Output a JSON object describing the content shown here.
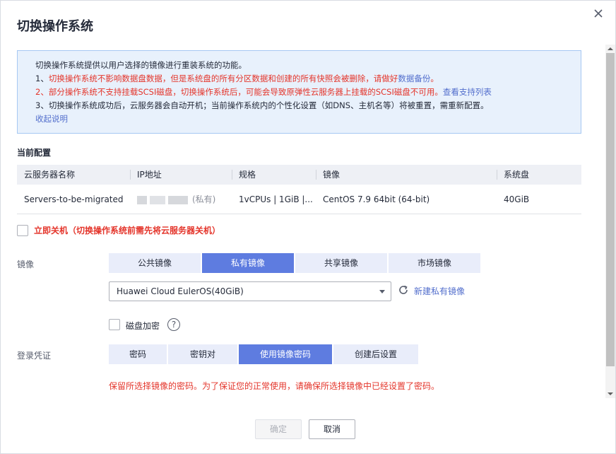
{
  "dialog": {
    "title": "切换操作系统"
  },
  "info": {
    "line0": "切换操作系统提供以用户选择的镜像进行重装系统的功能。",
    "line1_prefix": "1、",
    "line1_red": "切换操作系统不影响数据盘数据，但是系统盘的所有分区数据和创建的所有快照会被删除，请做好",
    "line1_link": "数据备份",
    "line1_suffix": "。",
    "line2_red": "2、部分操作系统不支持挂载SCSI磁盘，切换操作系统后，可能会导致原弹性云服务器上挂载的SCSI磁盘不可用。",
    "line2_link": "查看支持列表",
    "line3": "3、切换操作系统成功后，云服务器会自动开机；当前操作系统内的个性化设置（如DNS、主机名等）将被重置，需重新配置。",
    "collapse": "收起说明"
  },
  "current": {
    "label": "当前配置",
    "headers": [
      "云服务器名称",
      "IP地址",
      "规格",
      "镜像",
      "系统盘"
    ],
    "row": {
      "name": "Servers-to-be-migrated",
      "ip_suffix": "(私有)",
      "spec": "1vCPUs | 1GiB |...",
      "image": "CentOS 7.9 64bit (64-bit)",
      "disk": "40GiB"
    }
  },
  "shutdown": {
    "label": "立即关机（切换操作系统前需先将云服务器关机）",
    "checked": false
  },
  "image": {
    "label": "镜像",
    "tabs": [
      "公共镜像",
      "私有镜像",
      "共享镜像",
      "市场镜像"
    ],
    "active_tab": 1,
    "selected": "Huawei Cloud EulerOS(40GiB)",
    "new_private": "新建私有镜像",
    "encrypt": "磁盘加密",
    "help": "?"
  },
  "login": {
    "label": "登录凭证",
    "tabs": [
      "密码",
      "密钥对",
      "使用镜像密码",
      "创建后设置"
    ],
    "active_tab": 2,
    "note": "保留所选择镜像的密码。为了保证您的正常使用，请确保所选择镜像中已经设置了密码。"
  },
  "footer": {
    "ok": "确定",
    "cancel": "取消"
  },
  "colors": {
    "primary": "#5e7ce0",
    "link": "#526ecc",
    "danger": "#e4352b",
    "info_bg": "#e8f1fc"
  },
  "icons": {
    "close": "close-icon",
    "refresh": "refresh-icon",
    "dropdown": "chevron-down-icon"
  }
}
